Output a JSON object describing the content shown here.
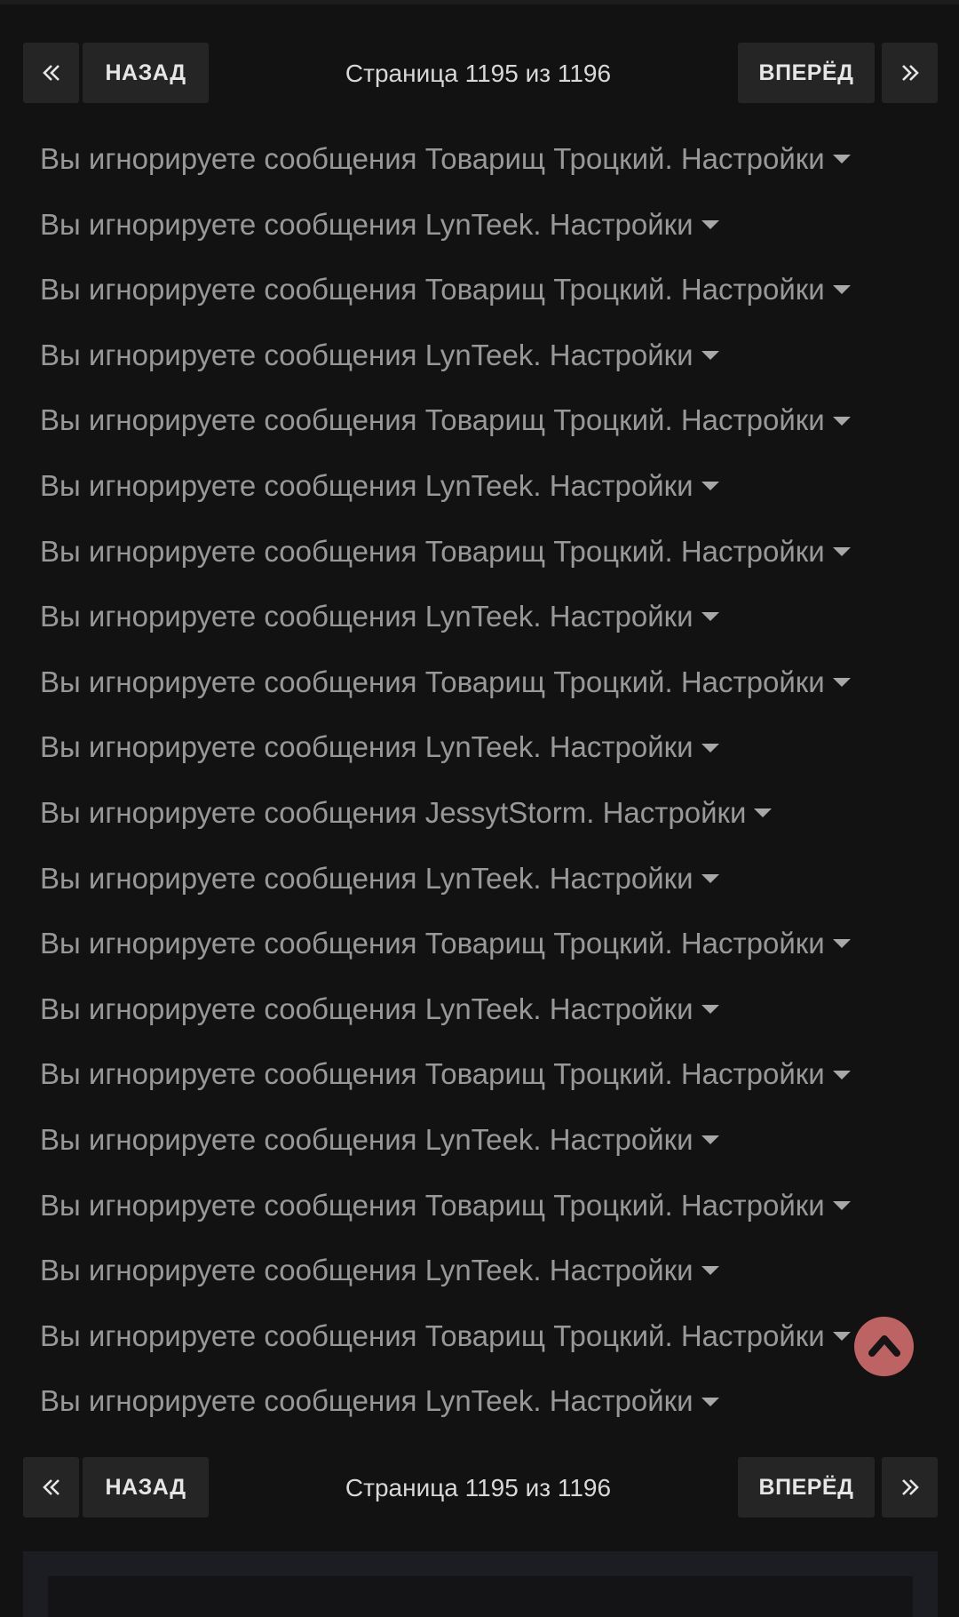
{
  "pager": {
    "first_symbol": "«",
    "prev_label": "НАЗАД",
    "page_info": "Страница 1195 из 1196",
    "next_label": "ВПЕРЁД",
    "last_symbol": "»"
  },
  "ignored": {
    "prefix": "Вы игнорируете сообщения",
    "settings_label": "Настройки",
    "items": [
      {
        "name": "Товарищ Троцкий"
      },
      {
        "name": "LynTeek"
      },
      {
        "name": "Товарищ Троцкий"
      },
      {
        "name": "LynTeek"
      },
      {
        "name": "Товарищ Троцкий"
      },
      {
        "name": "LynTeek"
      },
      {
        "name": "Товарищ Троцкий"
      },
      {
        "name": "LynTeek"
      },
      {
        "name": "Товарищ Троцкий"
      },
      {
        "name": "LynTeek"
      },
      {
        "name": "JessytStorm"
      },
      {
        "name": "LynTeek"
      },
      {
        "name": "Товарищ Троцкий"
      },
      {
        "name": "LynTeek"
      },
      {
        "name": "Товарищ Троцкий"
      },
      {
        "name": "LynTeek"
      },
      {
        "name": "Товарищ Троцкий"
      },
      {
        "name": "LynTeek"
      },
      {
        "name": "Товарищ Троцкий"
      },
      {
        "name": "LynTeek"
      }
    ]
  },
  "icons": {
    "first": "double-chevron-left-icon",
    "last": "double-chevron-right-icon",
    "caret": "caret-down-icon",
    "scroll_top": "chevron-up-icon"
  },
  "colors": {
    "background": "#121212",
    "button": "#252525",
    "text": "#989898",
    "scroll_button": "#d66e6e"
  }
}
